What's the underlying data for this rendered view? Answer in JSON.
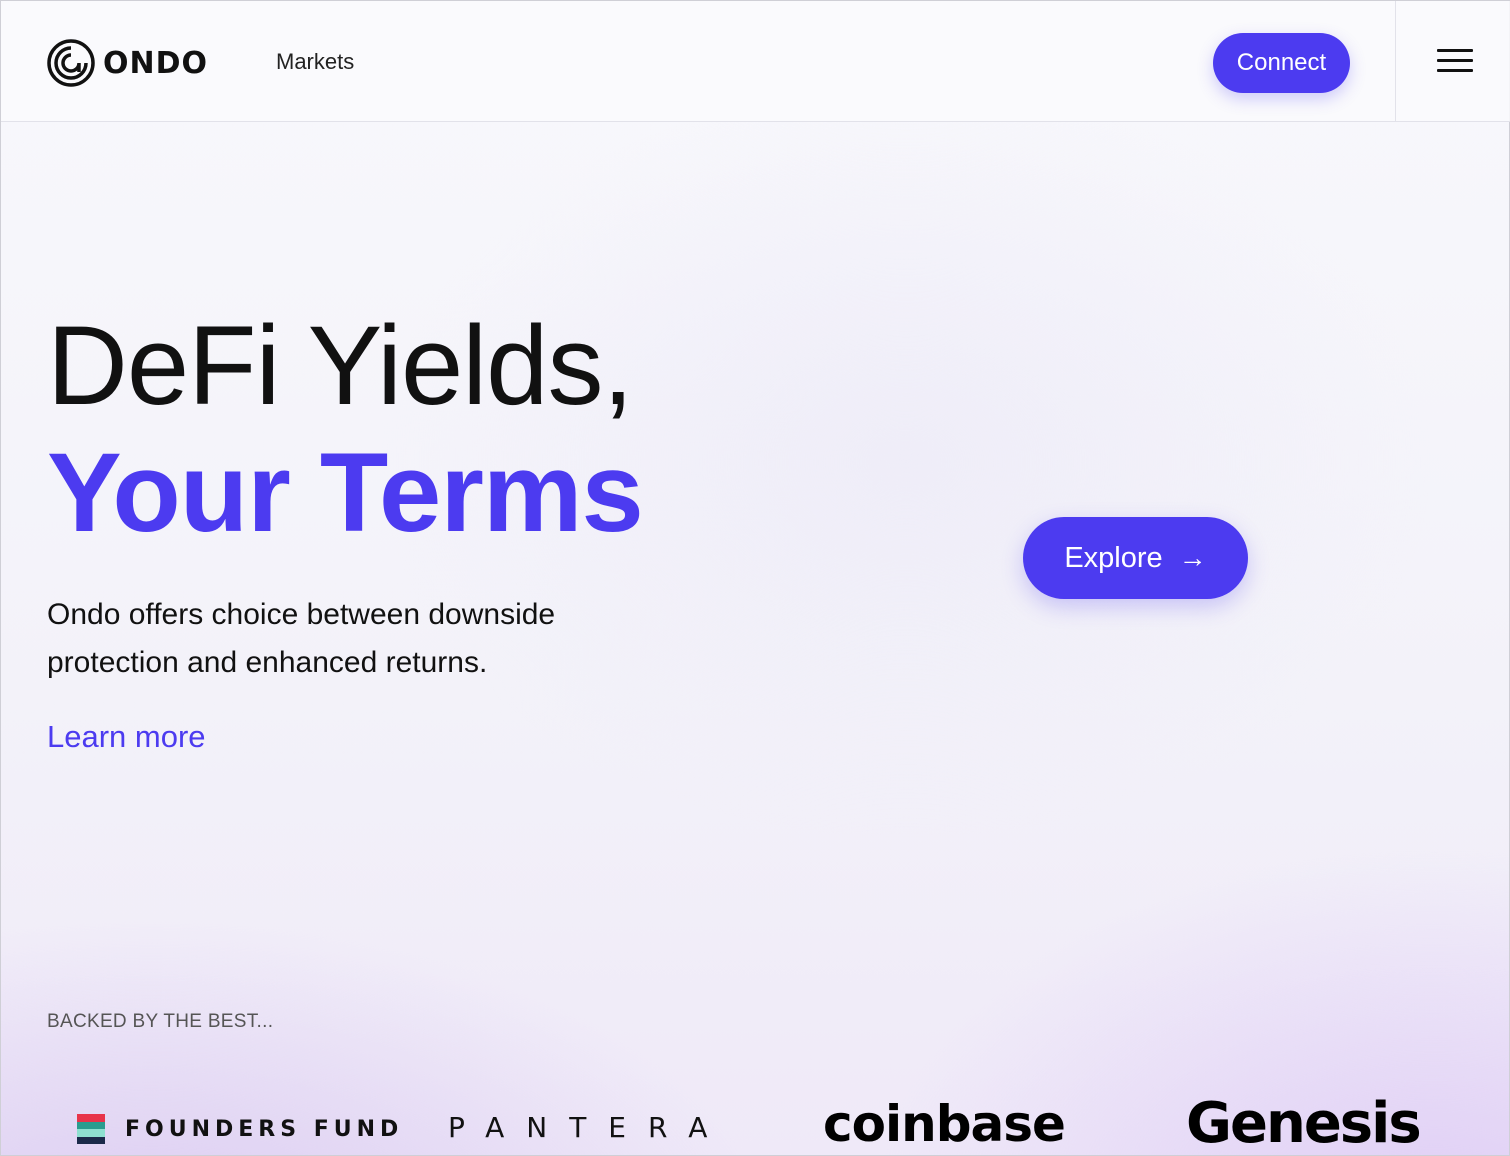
{
  "header": {
    "brand": "ONDO",
    "nav_markets": "Markets",
    "connect_label": "Connect"
  },
  "hero": {
    "line1": "DeFi Yields,",
    "line2": "Your Terms",
    "description": "Ondo offers choice between downside protection and enhanced returns.",
    "learn_more": "Learn more",
    "explore_label": "Explore",
    "explore_arrow": "→"
  },
  "backers": {
    "label": "BACKED BY THE BEST...",
    "founders_fund": "FOUNDERS FUND",
    "pantera": "PANTERA",
    "coinbase": "coinbase",
    "genesis": "Genesis"
  },
  "colors": {
    "accent": "#4c3bf0",
    "text": "#111111",
    "ff_stripes": [
      "#e8344a",
      "#2a9d8f",
      "#8ee0d0",
      "#1b2a4a"
    ]
  },
  "icons": {
    "brand": "ondo-concentric-logo-icon",
    "menu": "hamburger-menu-icon",
    "explore": "arrow-right-icon"
  }
}
